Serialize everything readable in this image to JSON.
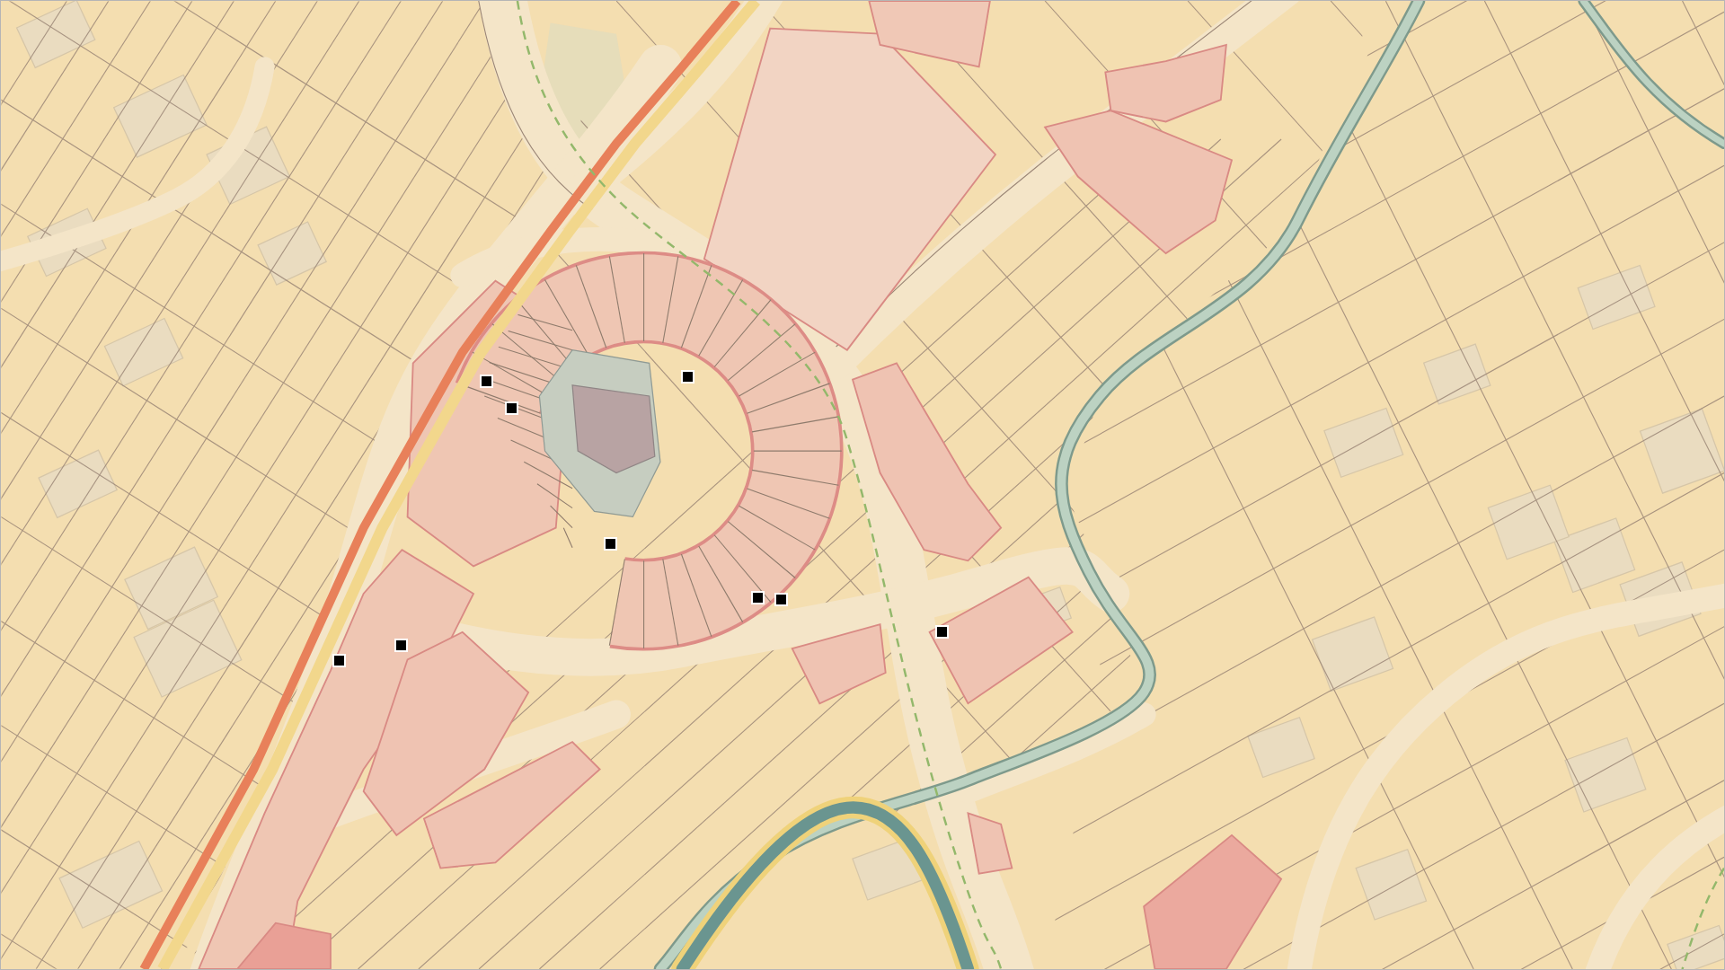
{
  "map": {
    "markers": [
      {
        "kind": "square"
      },
      {
        "kind": "square"
      },
      {
        "kind": "square"
      },
      {
        "kind": "square"
      },
      {
        "kind": "square"
      },
      {
        "kind": "square"
      },
      {
        "kind": "square"
      },
      {
        "kind": "square"
      },
      {
        "kind": "square"
      }
    ]
  }
}
